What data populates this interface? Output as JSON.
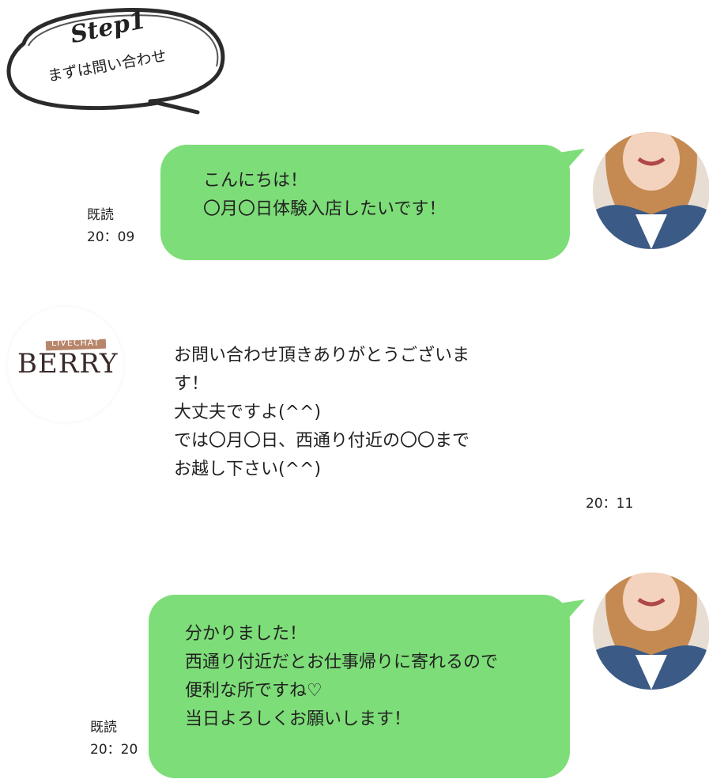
{
  "step": {
    "title": "Step1",
    "subtitle": "まずは問い合わせ"
  },
  "messages": [
    {
      "id": "msg1",
      "lines": [
        "こんにちは！",
        "〇月〇日体験入店したいです！"
      ],
      "read_label": "既読",
      "time": "20：09"
    },
    {
      "id": "msg2",
      "lines": [
        "お問い合わせ頂きありがとうございま",
        "す！",
        "大丈夫ですよ(^^)",
        "では〇月〇日、西通り付近の〇〇まで",
        "お越し下さい(^^)"
      ],
      "time": "20：11"
    },
    {
      "id": "msg3",
      "lines": [
        "分かりました！",
        "西通り付近だとお仕事帰りに寄れるので",
        "便利な所ですね♡",
        "当日よろしくお願いします！"
      ],
      "read_label": "既読",
      "time": "20：20"
    }
  ],
  "logo": {
    "small_text": "LIVECHAT",
    "main_text": "BERRY"
  },
  "colors": {
    "bubble": "#7ddd78",
    "text": "#222222"
  }
}
